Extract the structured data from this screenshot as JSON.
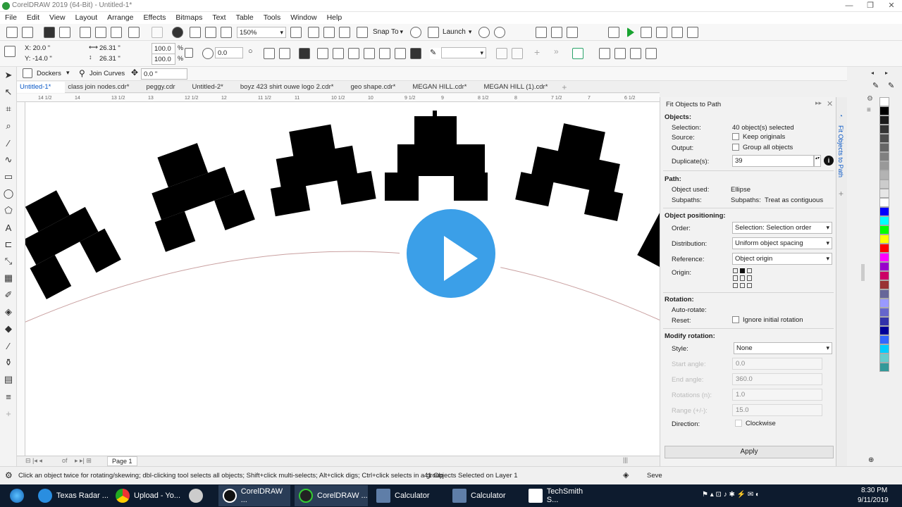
{
  "window": {
    "title": "CorelDRAW 2019 (64-Bit) - Untitled-1*"
  },
  "menu": [
    "File",
    "Edit",
    "View",
    "Layout",
    "Arrange",
    "Effects",
    "Bitmaps",
    "Text",
    "Table",
    "Tools",
    "Window",
    "Help"
  ],
  "standard_bar": {
    "zoom": "150%",
    "snap_to": "Snap To",
    "launch": "Launch"
  },
  "property_bar": {
    "x": "X: 20.0 \"",
    "y": "Y: -14.0 \"",
    "w": "26.31 \"",
    "h": "26.31 \"",
    "sx": "100.0",
    "sy": "100.0",
    "pct1": "%",
    "pct2": "%",
    "rotation": "0.0"
  },
  "docker_bar": {
    "dockers": "Dockers",
    "join_curves": "Join Curves",
    "value": "0.0 \""
  },
  "tabs": [
    "Untitled-1*",
    "class join nodes.cdr*",
    "peggy.cdr",
    "Untitled-2*",
    "boyz 423 shirt ouwe logo 2.cdr*",
    "geo shape.cdr*",
    "MEGAN HILL.cdr*",
    "MEGAN HILL (1).cdr*"
  ],
  "ruler_marks": [
    "14 1/2",
    "14",
    "13 1/2",
    "13",
    "12 1/2",
    "12",
    "11 1/2",
    "11",
    "10 1/2",
    "10",
    "9 1/2",
    "9",
    "8 1/2",
    "8",
    "7 1/2",
    "7",
    "6 1/2"
  ],
  "page_bar": {
    "page_label": "Page 1",
    "of": "of"
  },
  "docker": {
    "title": "Fit Objects to Path",
    "side_tab": "Fit Objects to Path",
    "objects_heading": "Objects:",
    "selection_label": "Selection:",
    "selection_value": "40 object(s) selected",
    "source_label": "Source:",
    "keep_originals": "Keep originals",
    "output_label": "Output:",
    "group_all": "Group all objects",
    "duplicates_label": "Duplicate(s):",
    "duplicates_value": "39",
    "path_heading": "Path:",
    "object_used_label": "Object used:",
    "object_used_value": "Ellipse",
    "subpaths_label": "Subpaths:",
    "subpaths_value": "Subpaths:",
    "subpaths_mode": "Treat as contiguous",
    "positioning_heading": "Object positioning:",
    "order_label": "Order:",
    "order_value": "Selection: Selection order",
    "distribution_label": "Distribution:",
    "distribution_value": "Uniform object spacing",
    "reference_label": "Reference:",
    "reference_value": "Object origin",
    "origin_label": "Origin:",
    "rotation_heading": "Rotation:",
    "auto_rotate_label": "Auto-rotate:",
    "reset_label": "Reset:",
    "ignore_initial": "Ignore initial rotation",
    "modify_heading": "Modify rotation:",
    "style_label": "Style:",
    "style_value": "None",
    "start_angle_label": "Start angle:",
    "start_angle": "0.0",
    "end_angle_label": "End angle:",
    "end_angle": "360.0",
    "rotations_label": "Rotations (n):",
    "rotations": "1.0",
    "range_label": "Range (+/-):",
    "range": "15.0",
    "direction_label": "Direction:",
    "clockwise": "Clockwise",
    "apply": "Apply"
  },
  "palette_colors": [
    "#ffffff",
    "#000000",
    "#1a1a1a",
    "#333333",
    "#4d4d4d",
    "#666666",
    "#808080",
    "#999999",
    "#b3b3b3",
    "#cccccc",
    "#e6e6e6",
    "#ffffff",
    "#0000ff",
    "#00ffff",
    "#00ff00",
    "#ffff00",
    "#ff0000",
    "#ff00ff",
    "#9900cc",
    "#cc0066",
    "#993333",
    "#666699",
    "#9999ff",
    "#6666cc",
    "#3333aa",
    "#000099",
    "#3366ff",
    "#00ccff",
    "#66cccc",
    "#339999"
  ],
  "status": {
    "hint": "Click an object twice for rotating/skewing; dbl-clicking tool selects all objects; Shift+click multi-selects; Alt+click digs; Ctrl+click selects in a group",
    "selected": "41 Objects Selected on Layer 1",
    "fill": "Seve"
  },
  "taskbar": {
    "items": [
      "Texas Radar ...",
      "Upload - Yo...",
      "",
      "CorelDRAW ...",
      "CorelDRAW ...",
      "Calculator",
      "Calculator",
      "TechSmith S..."
    ],
    "time": "8:30 PM",
    "date": "9/11/2019"
  }
}
